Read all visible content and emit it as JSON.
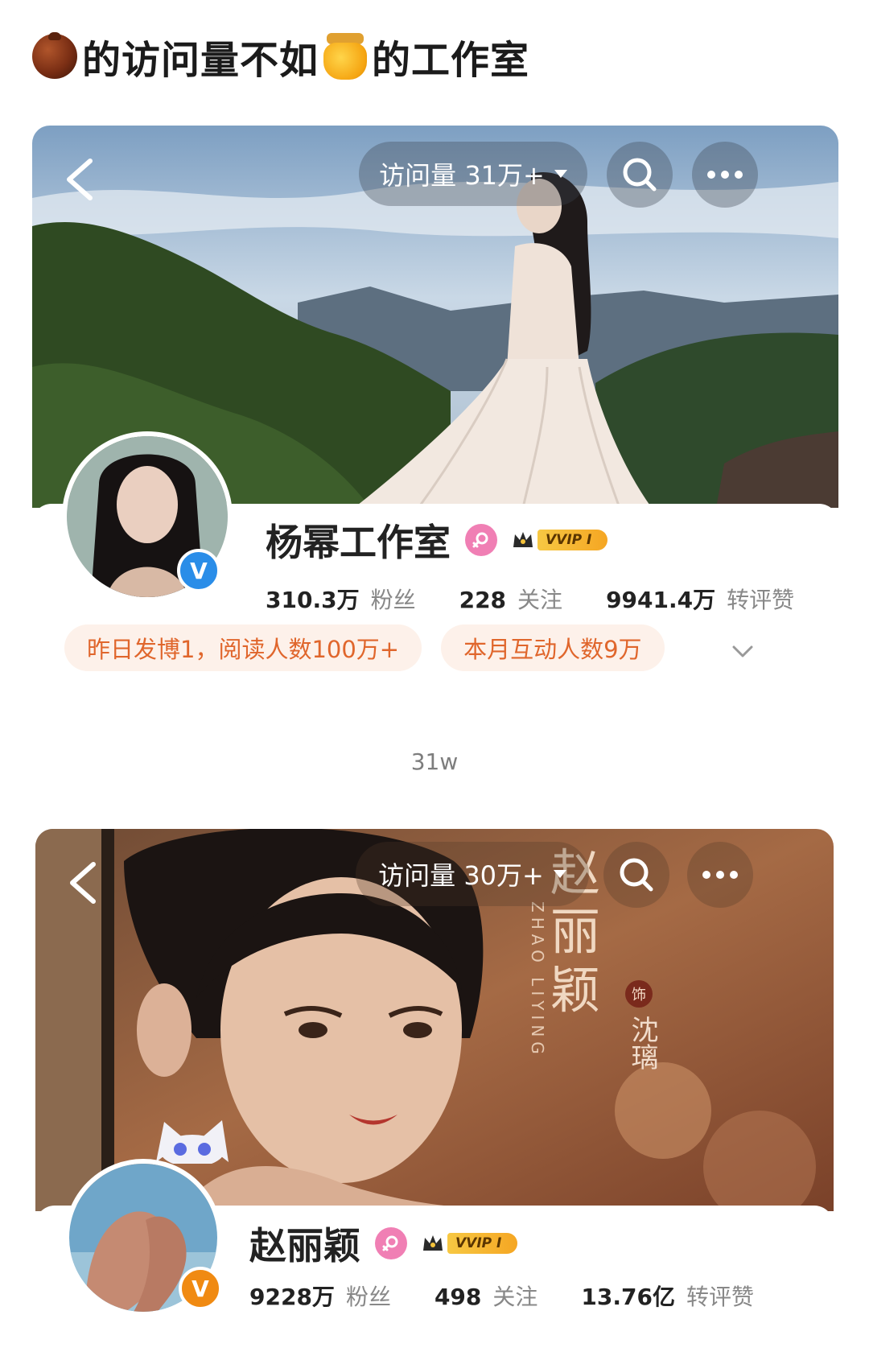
{
  "headline": {
    "text_a": "的访问量不如",
    "text_b": "的工作室"
  },
  "icons": [
    "chestnut-emoji",
    "honey-pot-emoji",
    "back-chevron-icon",
    "search-icon",
    "more-icon",
    "female-icon",
    "vvip-crown-icon",
    "verified-v-icon",
    "chevron-down-icon"
  ],
  "profiles": [
    {
      "visits": "访问量 31万+",
      "name": "杨幂工作室",
      "vvip": "VVIP I",
      "verify": "V",
      "stats": [
        {
          "num": "310.3万",
          "label": "粉丝"
        },
        {
          "num": "228",
          "label": "关注"
        },
        {
          "num": "9941.4万",
          "label": "转评赞"
        }
      ],
      "chips": [
        "昨日发博1，阅读人数100万+",
        "本月互动人数9万"
      ],
      "colors": {
        "verify": "#2a8de8"
      }
    },
    {
      "visits": "访问量 30万+",
      "name": "赵丽颖",
      "vvip": "VVIP I",
      "verify": "V",
      "poster_text": {
        "title": "赵丽颖",
        "pinyin": "ZHAO LIYING",
        "role": "沈璃",
        "seal": "饰"
      },
      "stats": [
        {
          "num": "9228万",
          "label": "粉丝"
        },
        {
          "num": "498",
          "label": "关注"
        },
        {
          "num": "13.76亿",
          "label": "转评赞"
        }
      ],
      "colors": {
        "verify": "#f08a12"
      }
    }
  ],
  "caption": "31w"
}
